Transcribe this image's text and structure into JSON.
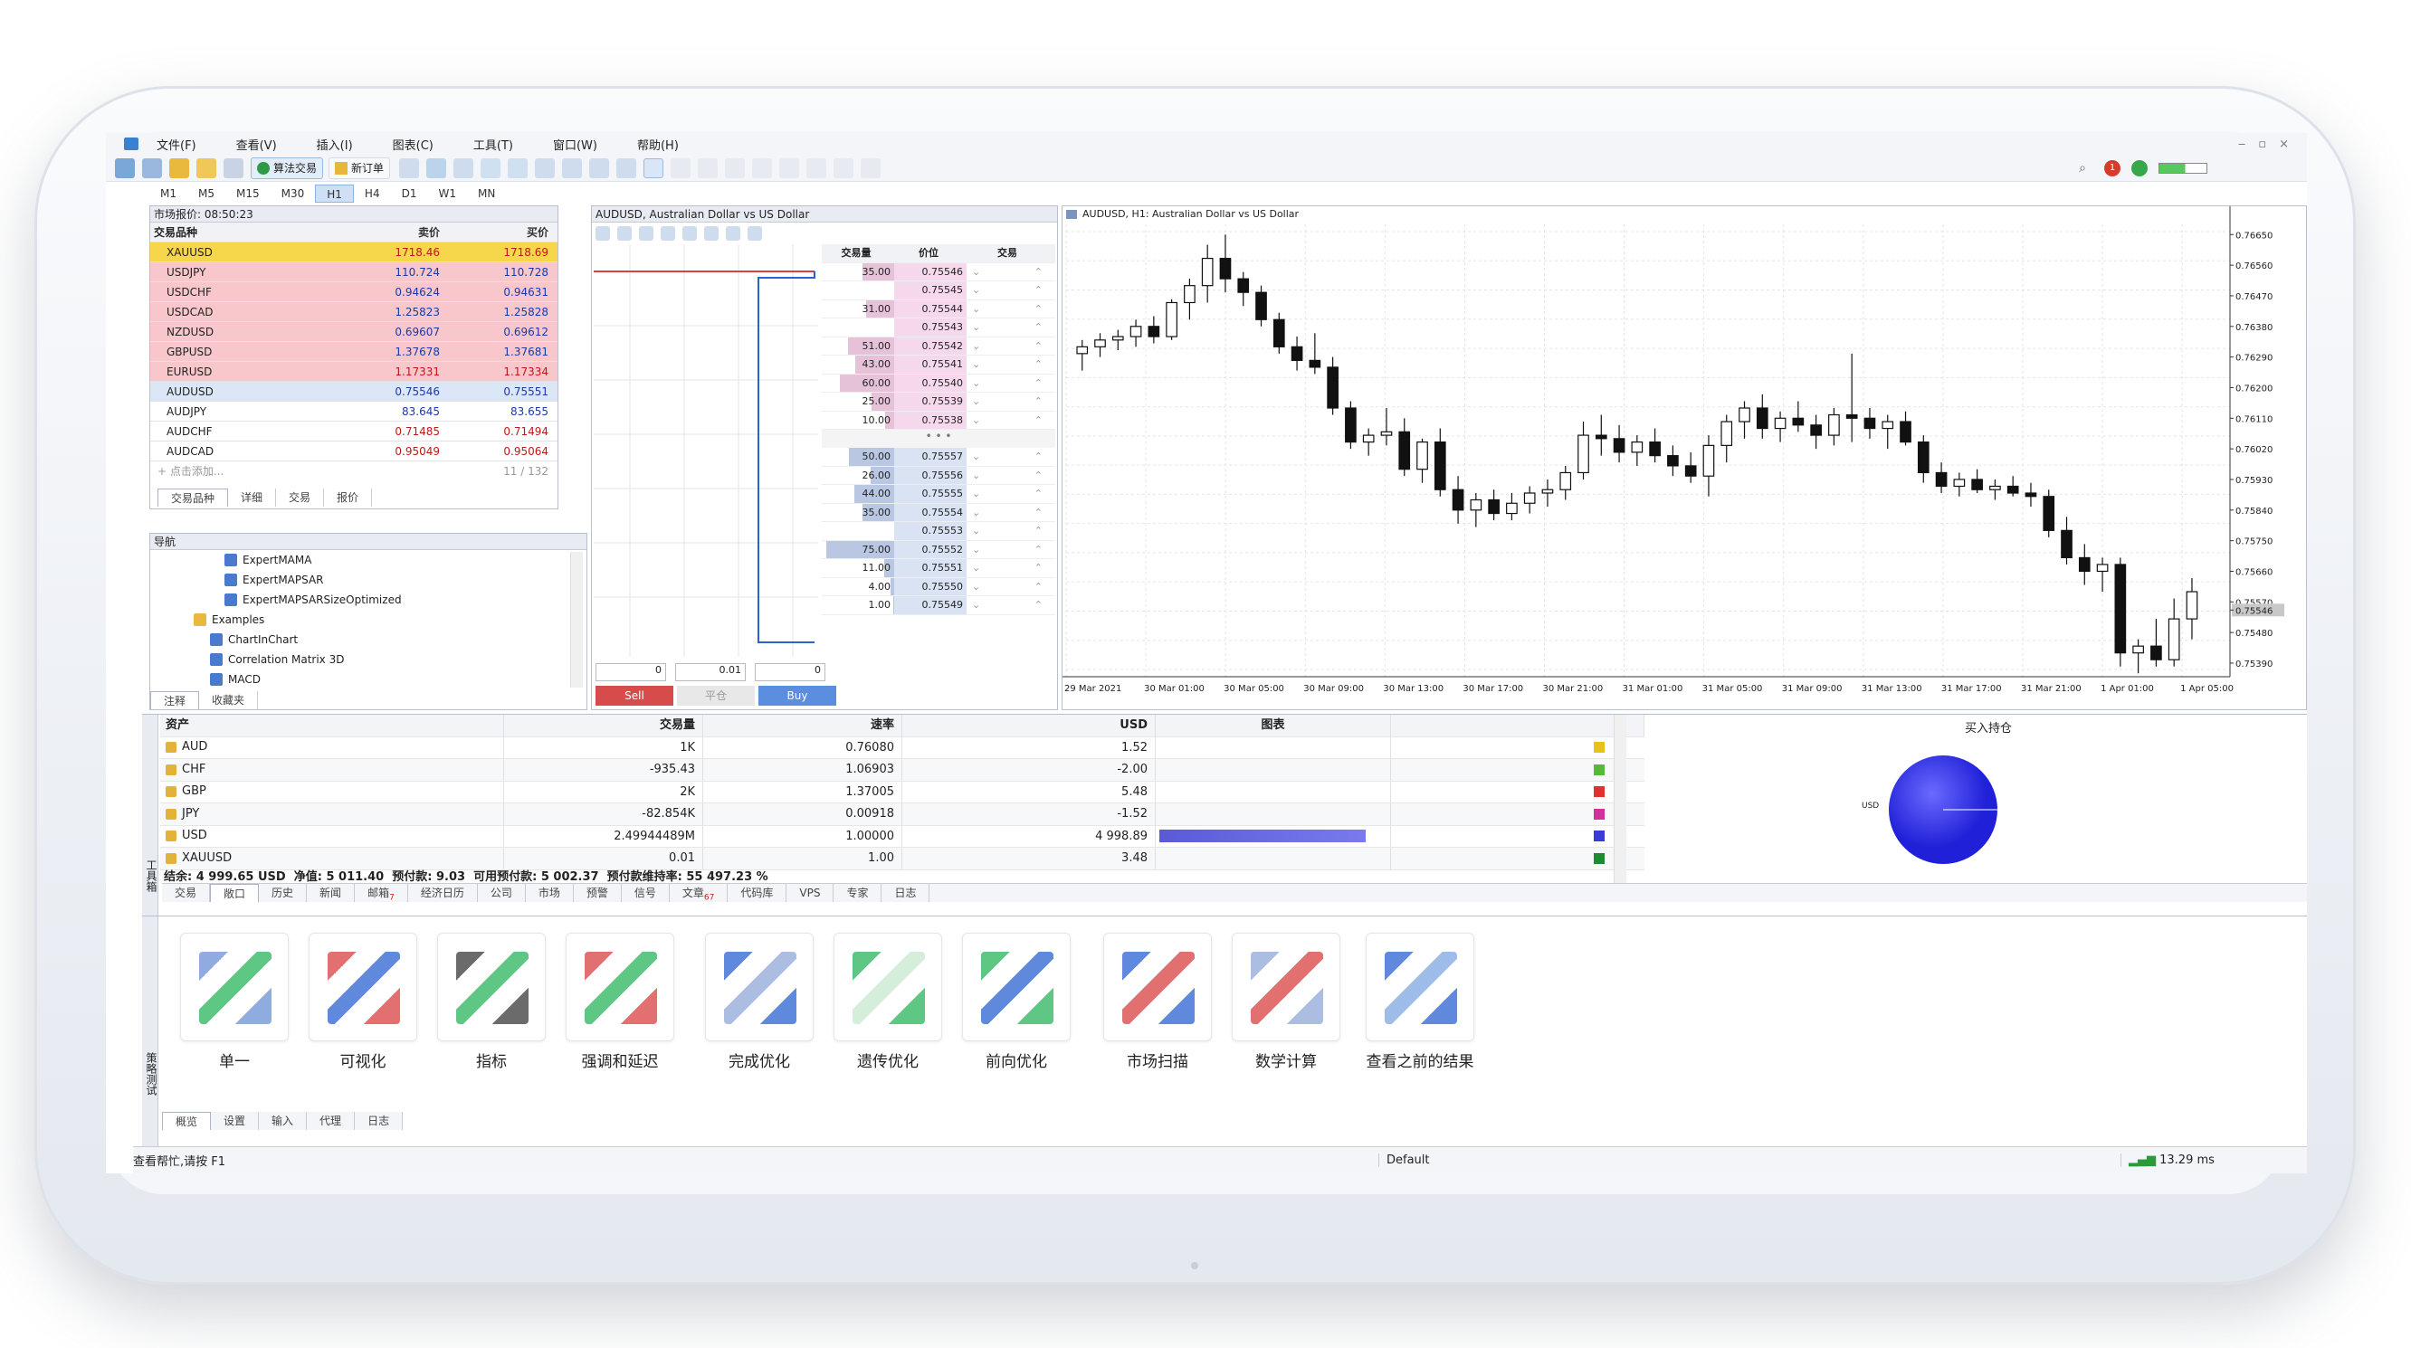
{
  "menu": [
    "文件(F)",
    "查看(V)",
    "插入(I)",
    "图表(C)",
    "工具(T)",
    "窗口(W)",
    "帮助(H)"
  ],
  "toolbar": {
    "algo_trading": "算法交易",
    "new_order": "新订单",
    "ping_badge": "1"
  },
  "timeframes": [
    "M1",
    "M5",
    "M15",
    "M30",
    "H1",
    "H4",
    "D1",
    "W1",
    "MN"
  ],
  "timeframe_selected": "H1",
  "market_watch": {
    "title": "市场报价: 08:50:23",
    "col_symbol": "交易品种",
    "col_bid": "卖价",
    "col_ask": "买价",
    "rows": [
      {
        "symbol": "XAUUSD",
        "bid": "1718.46",
        "ask": "1718.69",
        "style": "yellow"
      },
      {
        "symbol": "USDJPY",
        "bid": "110.724",
        "ask": "110.728",
        "style": "pink"
      },
      {
        "symbol": "USDCHF",
        "bid": "0.94624",
        "ask": "0.94631",
        "style": "pink"
      },
      {
        "symbol": "USDCAD",
        "bid": "1.25823",
        "ask": "1.25828",
        "style": "pink"
      },
      {
        "symbol": "NZDUSD",
        "bid": "0.69607",
        "ask": "0.69612",
        "style": "pink"
      },
      {
        "symbol": "GBPUSD",
        "bid": "1.37678",
        "ask": "1.37681",
        "style": "pink"
      },
      {
        "symbol": "EURUSD",
        "bid": "1.17331",
        "ask": "1.17334",
        "style": "pink"
      },
      {
        "symbol": "AUDUSD",
        "bid": "0.75546",
        "ask": "0.75551",
        "style": "blue"
      },
      {
        "symbol": "AUDJPY",
        "bid": "83.645",
        "ask": "83.655",
        "style": "white"
      },
      {
        "symbol": "AUDCHF",
        "bid": "0.71485",
        "ask": "0.71494",
        "style": "white"
      },
      {
        "symbol": "AUDCAD",
        "bid": "0.95049",
        "ask": "0.95064",
        "style": "white"
      }
    ],
    "add_label": "+ 点击添加...",
    "count": "11 / 132",
    "tabs": [
      "交易品种",
      "详细",
      "交易",
      "报价"
    ]
  },
  "navigator": {
    "title": "导航",
    "items": [
      "ExpertMAMA",
      "ExpertMAPSAR",
      "ExpertMAPSARSizeOptimized",
      "Examples",
      "ChartInChart",
      "Correlation Matrix 3D",
      "MACD"
    ],
    "tabs": [
      "注释",
      "收藏夹"
    ]
  },
  "dom": {
    "title": "AUDUSD, Australian Dollar vs US Dollar",
    "col_volume": "交易量",
    "col_price": "价位",
    "col_trade": "交易",
    "sell_rows": [
      [
        "35.00",
        "0.75546"
      ],
      [
        "",
        "0.75545"
      ],
      [
        "31.00",
        "0.75544"
      ],
      [
        "",
        "0.75543"
      ],
      [
        "51.00",
        "0.75542"
      ],
      [
        "43.00",
        "0.75541"
      ],
      [
        "60.00",
        "0.75540"
      ],
      [
        "25.00",
        "0.75539"
      ],
      [
        "10.00",
        "0.75538"
      ]
    ],
    "buy_rows": [
      [
        "50.00",
        "0.75557"
      ],
      [
        "26.00",
        "0.75556"
      ],
      [
        "44.00",
        "0.75555"
      ],
      [
        "35.00",
        "0.75554"
      ],
      [
        "",
        "0.75553"
      ],
      [
        "75.00",
        "0.75552"
      ],
      [
        "11.00",
        "0.75551"
      ],
      [
        "4.00",
        "0.75550"
      ],
      [
        "1.00",
        "0.75549"
      ]
    ],
    "qty1": "0",
    "qty2": "0.01",
    "qty3": "0",
    "sell": "Sell",
    "close": "平仓",
    "buy": "Buy"
  },
  "chart": {
    "title": "AUDUSD, H1: Australian Dollar vs US Dollar",
    "price_ticks": [
      "0.76650",
      "0.76560",
      "0.76470",
      "0.76380",
      "0.76290",
      "0.76200",
      "0.76110",
      "0.76020",
      "0.75930",
      "0.75840",
      "0.75750",
      "0.75660",
      "0.75570",
      "0.75546",
      "0.75480",
      "0.75390"
    ],
    "time_ticks": [
      "29 Mar 2021",
      "30 Mar 01:00",
      "30 Mar 05:00",
      "30 Mar 09:00",
      "30 Mar 13:00",
      "30 Mar 17:00",
      "30 Mar 21:00",
      "31 Mar 01:00",
      "31 Mar 05:00",
      "31 Mar 09:00",
      "31 Mar 13:00",
      "31 Mar 17:00",
      "31 Mar 21:00",
      "1 Apr 01:00",
      "1 Apr 05:00"
    ]
  },
  "chart_data": {
    "type": "candlestick",
    "ylim": [
      0.7535,
      0.7668
    ],
    "ohlc": [
      [
        0.763,
        0.7634,
        0.7625,
        0.7632
      ],
      [
        0.7632,
        0.7636,
        0.7629,
        0.7634
      ],
      [
        0.7634,
        0.7637,
        0.7631,
        0.7635
      ],
      [
        0.7635,
        0.764,
        0.7632,
        0.7638
      ],
      [
        0.7638,
        0.7641,
        0.7633,
        0.7635
      ],
      [
        0.7635,
        0.7646,
        0.7634,
        0.7645
      ],
      [
        0.7645,
        0.7652,
        0.764,
        0.765
      ],
      [
        0.765,
        0.7662,
        0.7645,
        0.7658
      ],
      [
        0.7658,
        0.7665,
        0.7648,
        0.7652
      ],
      [
        0.7652,
        0.7654,
        0.7644,
        0.7648
      ],
      [
        0.7648,
        0.765,
        0.7638,
        0.764
      ],
      [
        0.764,
        0.7642,
        0.763,
        0.7632
      ],
      [
        0.7632,
        0.7635,
        0.7625,
        0.7628
      ],
      [
        0.7628,
        0.7636,
        0.7624,
        0.7626
      ],
      [
        0.7626,
        0.7629,
        0.7612,
        0.7614
      ],
      [
        0.7614,
        0.7616,
        0.7602,
        0.7604
      ],
      [
        0.7604,
        0.7608,
        0.76,
        0.7606
      ],
      [
        0.7606,
        0.7614,
        0.7603,
        0.7607
      ],
      [
        0.7607,
        0.7611,
        0.7594,
        0.7596
      ],
      [
        0.7596,
        0.7605,
        0.7592,
        0.7604
      ],
      [
        0.7604,
        0.7608,
        0.7588,
        0.759
      ],
      [
        0.759,
        0.7594,
        0.758,
        0.7584
      ],
      [
        0.7584,
        0.7589,
        0.7579,
        0.7587
      ],
      [
        0.7587,
        0.759,
        0.7581,
        0.7583
      ],
      [
        0.7583,
        0.7589,
        0.7581,
        0.7586
      ],
      [
        0.7586,
        0.7591,
        0.7583,
        0.7589
      ],
      [
        0.7589,
        0.7593,
        0.7585,
        0.759
      ],
      [
        0.759,
        0.7597,
        0.7587,
        0.7595
      ],
      [
        0.7595,
        0.761,
        0.7593,
        0.7606
      ],
      [
        0.7606,
        0.7612,
        0.76,
        0.7605
      ],
      [
        0.7605,
        0.7609,
        0.7598,
        0.7601
      ],
      [
        0.7601,
        0.7606,
        0.7597,
        0.7604
      ],
      [
        0.7604,
        0.7608,
        0.7598,
        0.76
      ],
      [
        0.76,
        0.7603,
        0.7594,
        0.7597
      ],
      [
        0.7597,
        0.7601,
        0.7592,
        0.7594
      ],
      [
        0.7594,
        0.7606,
        0.7588,
        0.7603
      ],
      [
        0.7603,
        0.7612,
        0.7598,
        0.761
      ],
      [
        0.761,
        0.7616,
        0.7605,
        0.7614
      ],
      [
        0.7614,
        0.7618,
        0.7605,
        0.7608
      ],
      [
        0.7608,
        0.7613,
        0.7604,
        0.7611
      ],
      [
        0.7611,
        0.7616,
        0.7607,
        0.7609
      ],
      [
        0.7609,
        0.7612,
        0.7602,
        0.7606
      ],
      [
        0.7606,
        0.7614,
        0.7603,
        0.7612
      ],
      [
        0.7612,
        0.763,
        0.7604,
        0.7611
      ],
      [
        0.7611,
        0.7614,
        0.7605,
        0.7608
      ],
      [
        0.7608,
        0.7612,
        0.7602,
        0.761
      ],
      [
        0.761,
        0.7613,
        0.7603,
        0.7604
      ],
      [
        0.7604,
        0.7606,
        0.7592,
        0.7595
      ],
      [
        0.7595,
        0.7598,
        0.7589,
        0.7591
      ],
      [
        0.7591,
        0.7595,
        0.7588,
        0.7593
      ],
      [
        0.7593,
        0.7596,
        0.7589,
        0.759
      ],
      [
        0.759,
        0.7593,
        0.7587,
        0.7591
      ],
      [
        0.7591,
        0.7594,
        0.7588,
        0.7589
      ],
      [
        0.7589,
        0.7592,
        0.7585,
        0.7588
      ],
      [
        0.7588,
        0.759,
        0.7576,
        0.7578
      ],
      [
        0.7578,
        0.7582,
        0.7568,
        0.757
      ],
      [
        0.757,
        0.7574,
        0.7562,
        0.7566
      ],
      [
        0.7566,
        0.757,
        0.756,
        0.7568
      ],
      [
        0.7568,
        0.757,
        0.7538,
        0.7542
      ],
      [
        0.7542,
        0.7546,
        0.7536,
        0.7544
      ],
      [
        0.7544,
        0.7552,
        0.7538,
        0.754
      ],
      [
        0.754,
        0.7558,
        0.7538,
        0.7552
      ],
      [
        0.7552,
        0.7564,
        0.7546,
        0.756
      ]
    ]
  },
  "assets": {
    "cols": [
      "资产",
      "交易量",
      "速率",
      "USD",
      "图表",
      "买入持仓"
    ],
    "rows": [
      {
        "asset": "AUD",
        "volume": "1K",
        "rate": "0.76080",
        "usd": "1.52",
        "color": "#e6c21a",
        "bar": 0
      },
      {
        "asset": "CHF",
        "volume": "-935.43",
        "rate": "1.06903",
        "usd": "-2.00",
        "color": "#58b83c",
        "bar": 0
      },
      {
        "asset": "GBP",
        "volume": "2K",
        "rate": "1.37005",
        "usd": "5.48",
        "color": "#e03030",
        "bar": 0
      },
      {
        "asset": "JPY",
        "volume": "-82.854K",
        "rate": "0.00918",
        "usd": "-1.52",
        "color": "#d0329a",
        "bar": 0
      },
      {
        "asset": "USD",
        "volume": "2.49944489M",
        "rate": "1.00000",
        "usd": "4 998.89",
        "color": "#3a3ad8",
        "bar": 1
      },
      {
        "asset": "XAUUSD",
        "volume": "0.01",
        "rate": "1.00",
        "usd": "3.48",
        "color": "#1f8a32",
        "bar": 0
      }
    ],
    "pie_label": "USD",
    "summary": "结余: 4 999.65 USD  净值: 5 011.40  预付款: 9.03  可用预付款: 5 002.37  预付款维持率: 55 497.23 %"
  },
  "toolbox_tabs": [
    {
      "label": "交易"
    },
    {
      "label": "敞口"
    },
    {
      "label": "历史"
    },
    {
      "label": "新闻"
    },
    {
      "label": "邮箱",
      "badge": "7"
    },
    {
      "label": "经济日历"
    },
    {
      "label": "公司"
    },
    {
      "label": "市场"
    },
    {
      "label": "预警"
    },
    {
      "label": "信号"
    },
    {
      "label": "文章",
      "badge": "67"
    },
    {
      "label": "代码库"
    },
    {
      "label": "VPS"
    },
    {
      "label": "专家"
    },
    {
      "label": "日志"
    }
  ],
  "toolbox_side": "工具箱",
  "tester": {
    "side": "策略测试",
    "tools": [
      "单一",
      "可视化",
      "指标",
      "强调和延迟",
      "完成优化",
      "遗传优化",
      "前向优化",
      "市场扫描",
      "数学计算",
      "查看之前的结果"
    ],
    "tabs": [
      "概览",
      "设置",
      "输入",
      "代理",
      "日志"
    ]
  },
  "status": {
    "help": "查看帮忙,请按 F1",
    "profile": "Default",
    "ping": "13.29 ms"
  }
}
